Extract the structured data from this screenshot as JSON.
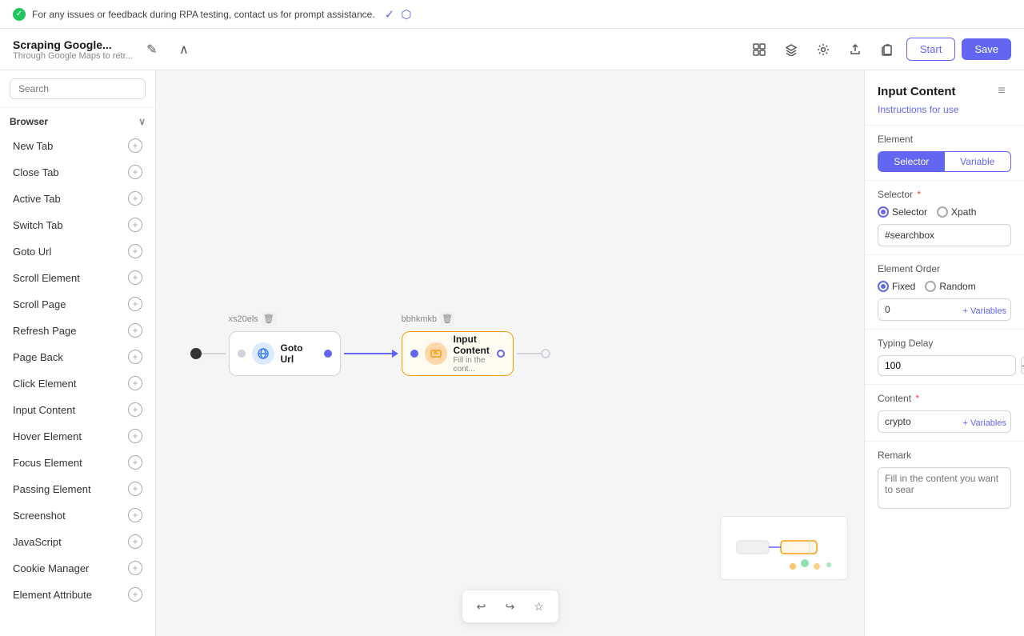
{
  "notification": {
    "icon": "✓",
    "text": "For any issues or feedback during RPA testing, contact us for prompt assistance."
  },
  "header": {
    "project_title": "Scraping Google...",
    "project_subtitle": "Through Google Maps to retr...",
    "edit_icon": "✎",
    "collapse_icon": "∧",
    "toolbar_icons": [
      "grid",
      "layers",
      "settings",
      "upload",
      "clipboard"
    ],
    "start_label": "Start",
    "save_label": "Save"
  },
  "sidebar": {
    "search_placeholder": "Search",
    "section_label": "Browser",
    "items": [
      {
        "label": "New Tab"
      },
      {
        "label": "Close Tab"
      },
      {
        "label": "Active Tab"
      },
      {
        "label": "Switch Tab"
      },
      {
        "label": "Goto Url"
      },
      {
        "label": "Scroll Element"
      },
      {
        "label": "Scroll Page"
      },
      {
        "label": "Refresh Page"
      },
      {
        "label": "Page Back"
      },
      {
        "label": "Click Element"
      },
      {
        "label": "Input Content"
      },
      {
        "label": "Hover Element"
      },
      {
        "label": "Focus Element"
      },
      {
        "label": "Passing Element"
      },
      {
        "label": "Screenshot"
      },
      {
        "label": "JavaScript"
      },
      {
        "label": "Cookie Manager"
      },
      {
        "label": "Element Attribute"
      }
    ]
  },
  "canvas": {
    "nodes": [
      {
        "id": "xs20els",
        "type": "goto_url",
        "title": "Goto Url",
        "subtitle": "",
        "icon_type": "browser"
      },
      {
        "id": "bbhkmkb",
        "type": "input_content",
        "title": "Input Content",
        "subtitle": "Fill in the cont...",
        "icon_type": "input"
      }
    ]
  },
  "right_panel": {
    "title": "Input Content",
    "instructions_label": "Instructions for use",
    "element_label": "Element",
    "selector_tab": "Selector",
    "variable_tab": "Variable",
    "selector_label": "Selector",
    "selector_radio": "Selector",
    "xpath_radio": "Xpath",
    "selector_value": "#searchbox",
    "element_order_label": "Element Order",
    "fixed_radio": "Fixed",
    "random_radio": "Random",
    "order_value": "0",
    "variables_label": "+ Variables",
    "typing_delay_label": "Typing Delay",
    "typing_delay_value": "100",
    "content_label": "Content",
    "content_value": "crypto",
    "remark_label": "Remark",
    "remark_placeholder": "Fill in the content you want to sear"
  },
  "toolbar": {
    "undo_icon": "↩",
    "redo_icon": "↪",
    "star_icon": "☆"
  }
}
